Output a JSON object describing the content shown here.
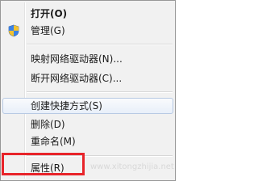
{
  "menu": {
    "items": [
      {
        "label": "打开(O)",
        "bold": true
      },
      {
        "label": "管理(G)",
        "icon": "uac-shield-icon"
      },
      {
        "label": "映射网络驱动器(N)..."
      },
      {
        "label": "断开网络驱动器(C)..."
      },
      {
        "label": "创建快捷方式(S)",
        "state": "hover"
      },
      {
        "label": "删除(D)"
      },
      {
        "label": "重命名(M)"
      },
      {
        "label": "属性(R)",
        "highlighted": true
      }
    ]
  },
  "annotation": {
    "color": "#e8242a"
  },
  "watermark": "www.xitongzhijia.net"
}
